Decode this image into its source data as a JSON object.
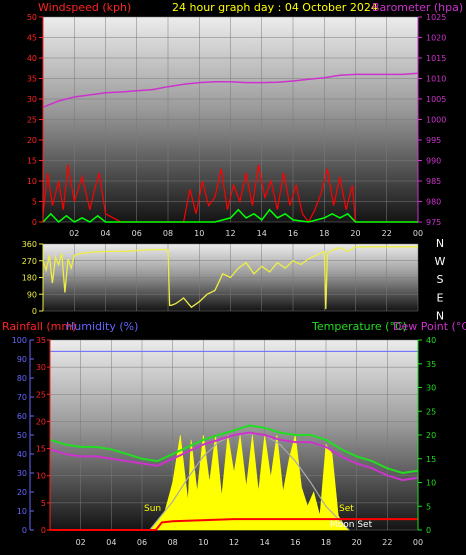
{
  "header": {
    "title": "24 hour graph day : 04 October 2024",
    "windspeed_label": "Windspeed (kph)",
    "barometer_label": "Barometer (hpa)"
  },
  "lower_header": {
    "rainfall_label": "Rainfall (mm)",
    "humidity_label": "Humidity (%)",
    "temperature_label": "Temperature (°C)",
    "dewpoint_label": "Dew Point (°C)"
  },
  "annotations": {
    "sunrise": "Sun",
    "sunset": "Set",
    "moonset": "Moon Set"
  },
  "time_ticks": [
    "02",
    "04",
    "06",
    "08",
    "10",
    "12",
    "14",
    "16",
    "18",
    "20",
    "22",
    "00"
  ],
  "colors": {
    "windspeed": "#ff0000",
    "gust": "#00ff00",
    "barometer": "#cc33cc",
    "direction": "#eeee44",
    "temperature": "#22dd22",
    "dewpoint": "#cc33cc",
    "humidity": "#6666ff",
    "rainfall": "#ff0000",
    "solar": "#ffff00",
    "solar_theoretical": "#aaaaaa"
  },
  "chart_data": [
    {
      "type": "line",
      "name": "wind-barometer",
      "x_range": [
        0,
        24
      ],
      "y_left": {
        "label": "Windspeed (kph)",
        "range": [
          0,
          50
        ],
        "ticks": [
          0,
          5,
          10,
          15,
          20,
          25,
          30,
          35,
          40,
          45,
          50
        ]
      },
      "y_right": {
        "label": "Barometer (hpa)",
        "range": [
          975,
          1025
        ],
        "ticks": [
          975,
          980,
          985,
          990,
          995,
          1000,
          1005,
          1010,
          1015,
          1020,
          1025
        ]
      },
      "series": [
        {
          "name": "Barometer",
          "axis": "right",
          "x": [
            0,
            1,
            2,
            3,
            4,
            5,
            6,
            7,
            8,
            9,
            10,
            11,
            12,
            13,
            14,
            15,
            16,
            17,
            18,
            19,
            20,
            21,
            22,
            23,
            24
          ],
          "y": [
            1003,
            1004.5,
            1005.5,
            1006,
            1006.5,
            1006.7,
            1007,
            1007.3,
            1008,
            1008.6,
            1009,
            1009.2,
            1009.2,
            1009,
            1009,
            1009.1,
            1009.4,
            1009.8,
            1010.2,
            1010.8,
            1011,
            1011,
            1011,
            1011,
            1011.3
          ]
        },
        {
          "name": "Windspeed",
          "axis": "left",
          "x": [
            0,
            0.3,
            0.6,
            1,
            1.3,
            1.6,
            2,
            2.5,
            3,
            3.3,
            3.6,
            4,
            5,
            6,
            7,
            8,
            9,
            9.4,
            9.8,
            10.2,
            10.6,
            11,
            11.4,
            11.8,
            12.2,
            12.6,
            13,
            13.4,
            13.8,
            14.2,
            14.6,
            15,
            15.4,
            15.8,
            16.2,
            16.6,
            17,
            17.4,
            17.8,
            18.2,
            18.6,
            19,
            19.4,
            19.8,
            20,
            21,
            22,
            23,
            24
          ],
          "y": [
            2,
            12,
            4,
            10,
            3,
            14,
            5,
            11,
            3,
            8,
            12,
            2,
            0,
            0,
            0,
            0,
            0,
            8,
            2,
            10,
            4,
            6,
            13,
            3,
            9,
            5,
            12,
            4,
            14,
            6,
            10,
            3,
            12,
            4,
            9,
            2,
            0,
            3,
            7,
            13,
            4,
            11,
            3,
            9,
            0,
            0,
            0,
            0,
            0
          ]
        },
        {
          "name": "Gust",
          "axis": "left",
          "x": [
            0,
            0.5,
            1,
            1.5,
            2,
            2.5,
            3,
            3.5,
            4,
            5,
            6,
            7,
            8,
            9,
            10,
            11,
            12,
            12.5,
            13,
            13.5,
            14,
            14.5,
            15,
            15.5,
            16,
            17,
            18,
            18.5,
            19,
            19.5,
            20,
            21,
            22,
            23,
            24
          ],
          "y": [
            0,
            2,
            0,
            1.5,
            0,
            1,
            0,
            1.5,
            0,
            0,
            0,
            0,
            0,
            0,
            0,
            0,
            1,
            3,
            1,
            2,
            0.5,
            3,
            1,
            2,
            0.5,
            0,
            1,
            2,
            1,
            2,
            0,
            0,
            0,
            0,
            0
          ]
        }
      ]
    },
    {
      "type": "line",
      "name": "wind-direction",
      "x_range": [
        0,
        24
      ],
      "y_left": {
        "range": [
          0,
          360
        ],
        "ticks": [
          0,
          90,
          180,
          270,
          360
        ]
      },
      "y_right": {
        "ticks": [
          "N",
          "W",
          "S",
          "E",
          "N"
        ]
      },
      "series": [
        {
          "name": "Direction",
          "x": [
            0,
            0.2,
            0.4,
            0.6,
            0.8,
            1,
            1.2,
            1.4,
            1.6,
            1.8,
            2,
            2.5,
            3,
            3.5,
            4,
            5,
            6,
            7,
            8,
            8.1,
            8.2,
            8.5,
            9,
            9.5,
            10,
            10.5,
            11,
            11.5,
            12,
            12.5,
            13,
            13.5,
            14,
            14.5,
            15,
            15.5,
            16,
            16.5,
            17,
            17.5,
            18,
            18.1,
            18.2,
            18.6,
            19,
            19.5,
            20,
            21,
            22,
            23,
            24
          ],
          "y": [
            270,
            220,
            300,
            150,
            290,
            250,
            310,
            100,
            280,
            230,
            300,
            310,
            315,
            318,
            320,
            320,
            325,
            330,
            330,
            30,
            30,
            40,
            70,
            20,
            50,
            90,
            110,
            200,
            180,
            230,
            260,
            200,
            240,
            210,
            260,
            230,
            270,
            250,
            280,
            300,
            320,
            10,
            310,
            330,
            340,
            320,
            345,
            345,
            345,
            345,
            345
          ]
        }
      ]
    },
    {
      "type": "line",
      "name": "temperature-humidity",
      "x_range": [
        0,
        24
      ],
      "y_left": {
        "label": "Humidity (%)",
        "range": [
          0,
          100
        ],
        "ticks": [
          0,
          10,
          20,
          30,
          40,
          50,
          60,
          70,
          80,
          90,
          100
        ]
      },
      "y_rain": {
        "label": "Rainfall (mm)",
        "range": [
          0,
          35
        ],
        "ticks": [
          0,
          5,
          10,
          15,
          20,
          25,
          30,
          35
        ]
      },
      "y_right": {
        "label": "Temperature (°C)",
        "range": [
          0,
          40
        ],
        "ticks": [
          0,
          5,
          10,
          15,
          20,
          25,
          30,
          35,
          40
        ]
      },
      "series": [
        {
          "name": "Temperature",
          "axis": "right",
          "x": [
            0,
            1,
            2,
            3,
            4,
            5,
            6,
            7,
            8,
            9,
            10,
            11,
            12,
            13,
            14,
            15,
            16,
            17,
            18,
            19,
            20,
            21,
            22,
            23,
            24
          ],
          "y": [
            19,
            18,
            17.5,
            17.5,
            17,
            16,
            15,
            14.5,
            16,
            17.5,
            19,
            20,
            21,
            22,
            21.5,
            20.5,
            20,
            20,
            19,
            17,
            15.5,
            14.5,
            13,
            12,
            12.5
          ]
        },
        {
          "name": "Dew Point",
          "axis": "right",
          "x": [
            0,
            1,
            2,
            3,
            4,
            5,
            6,
            7,
            8,
            9,
            10,
            11,
            12,
            13,
            14,
            15,
            16,
            17,
            18,
            19,
            20,
            21,
            22,
            23,
            24
          ],
          "y": [
            17,
            16,
            15.5,
            15.5,
            15,
            14.5,
            14,
            13.5,
            15,
            16.5,
            18,
            19,
            20,
            20.5,
            20,
            19,
            18.5,
            18.5,
            17.5,
            15.5,
            14,
            13,
            11.5,
            10.5,
            11
          ]
        },
        {
          "name": "Humidity",
          "axis": "left",
          "x": [
            0,
            24
          ],
          "y": [
            94,
            94
          ]
        },
        {
          "name": "Rainfall",
          "axis": "rain",
          "x": [
            0,
            6.9,
            7.3,
            8,
            12,
            16,
            24
          ],
          "y": [
            0,
            0,
            1.4,
            1.6,
            2,
            2,
            2
          ]
        },
        {
          "name": "Solar theoretical",
          "axis": "right",
          "x": [
            6.5,
            8,
            9,
            10,
            11,
            12,
            13,
            14,
            15,
            16,
            17,
            18,
            19.5
          ],
          "y": [
            0,
            6,
            11,
            15.5,
            18.5,
            20,
            20.3,
            20,
            18,
            14.5,
            10,
            5,
            0
          ]
        },
        {
          "name": "Solar",
          "axis": "right",
          "x": [
            6.5,
            7.5,
            8,
            8.5,
            9,
            9.2,
            9.6,
            10,
            10.4,
            10.8,
            11.2,
            11.6,
            12,
            12.4,
            12.8,
            13.2,
            13.6,
            14,
            14.4,
            14.8,
            15.2,
            15.6,
            16,
            16.4,
            16.8,
            17.2,
            17.6,
            18,
            18.4,
            18.8,
            19.2,
            19.5
          ],
          "y": [
            0,
            4,
            10,
            20,
            6,
            19,
            8,
            20,
            10,
            20,
            7,
            20,
            12,
            20,
            9,
            20,
            8,
            20,
            11,
            20,
            8,
            15,
            20,
            9,
            5,
            8,
            3,
            18,
            16,
            3,
            1,
            0
          ]
        }
      ]
    }
  ]
}
